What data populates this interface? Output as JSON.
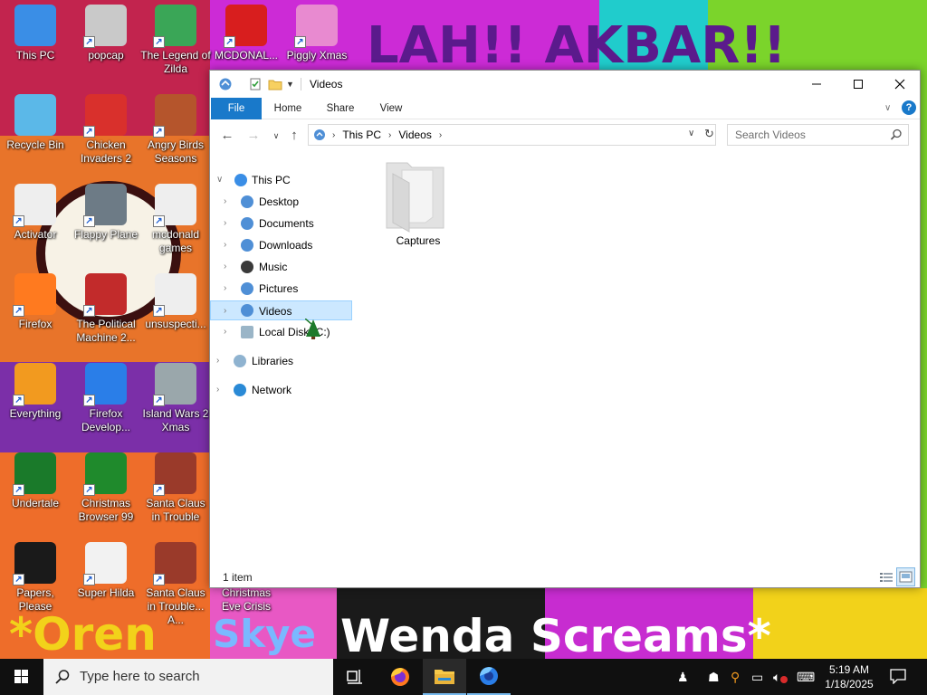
{
  "wallpaper": {
    "top_banner": "LAH!! AKBAR!!",
    "bottom_left": "*Oren",
    "bottom_mid": "Skye",
    "bottom_right": "Wenda Screams*"
  },
  "desktop_icons": [
    {
      "label": "This PC",
      "icon": "this-pc-icon",
      "color": "#3a8ee6"
    },
    {
      "label": "popcap",
      "icon": "popcap-icon",
      "color": "#c9c9c9"
    },
    {
      "label": "The Legend of Zilda",
      "icon": "zilda-icon",
      "color": "#3aa657"
    },
    {
      "label": "MCDONAL...",
      "icon": "mcdonalds-icon",
      "color": "#d81e1e"
    },
    {
      "label": "Piggly Xmas",
      "icon": "piggly-icon",
      "color": "#e88ad0"
    },
    {
      "label": "Recycle Bin",
      "icon": "recycle-bin-icon",
      "color": "#5bb8e8"
    },
    {
      "label": "Chicken Invaders 2",
      "icon": "chicken-icon",
      "color": "#d9302c"
    },
    {
      "label": "Angry Birds Seasons",
      "icon": "angry-birds-icon",
      "color": "#b5552c"
    },
    {
      "label": "Activator",
      "icon": "activator-icon",
      "color": "#eeeeee"
    },
    {
      "label": "Flappy Plane",
      "icon": "flappy-plane-icon",
      "color": "#6d7b86"
    },
    {
      "label": "mcdonald games",
      "icon": "mcdonald-games-icon",
      "color": "#eeeeee"
    },
    {
      "label": "Firefox",
      "icon": "firefox-icon",
      "color": "#ff7a1f"
    },
    {
      "label": "The Political Machine 2...",
      "icon": "political-machine-icon",
      "color": "#c22b2b"
    },
    {
      "label": "unsuspecti...",
      "icon": "unsuspecting-icon",
      "color": "#eeeeee"
    },
    {
      "label": "Everything",
      "icon": "everything-icon",
      "color": "#f29a1f"
    },
    {
      "label": "Firefox Develop...",
      "icon": "firefox-dev-icon",
      "color": "#2a7ee8"
    },
    {
      "label": "Island Wars 2 Xmas",
      "icon": "island-wars-icon",
      "color": "#9aa7ab"
    },
    {
      "label": "Undertale",
      "icon": "undertale-icon",
      "color": "#1a7a2a"
    },
    {
      "label": "Christmas Browser 99",
      "icon": "christmas-browser-icon",
      "color": "#1f8a2c"
    },
    {
      "label": "Santa Claus in Trouble",
      "icon": "santa-icon",
      "color": "#9a3a2a"
    },
    {
      "label": "Papers, Please",
      "icon": "papers-please-icon",
      "color": "#1a1a1a"
    },
    {
      "label": "Super Hilda",
      "icon": "super-hilda-icon",
      "color": "#f2f2f2"
    },
    {
      "label": "Santa Claus in Trouble... A...",
      "icon": "santa-2-icon",
      "color": "#9a3a2a"
    },
    {
      "label": "Christmas Eve Crisis",
      "icon": "christmas-eve-icon",
      "color": "#3a7ac8"
    }
  ],
  "explorer": {
    "title": "Videos",
    "tabs": [
      "File",
      "Home",
      "Share",
      "View"
    ],
    "breadcrumb": [
      "This PC",
      "Videos"
    ],
    "search_placeholder": "Search Videos",
    "nav_items": [
      {
        "label": "This PC",
        "icon": "this-pc-icon",
        "color": "#3a8ee6"
      },
      {
        "label": "Desktop",
        "icon": "desktop-icon",
        "color": "#4f8fd6"
      },
      {
        "label": "Documents",
        "icon": "documents-icon",
        "color": "#4f8fd6"
      },
      {
        "label": "Downloads",
        "icon": "downloads-icon",
        "color": "#4f8fd6"
      },
      {
        "label": "Music",
        "icon": "music-icon",
        "color": "#3a3a3a"
      },
      {
        "label": "Pictures",
        "icon": "pictures-icon",
        "color": "#4f8fd6"
      },
      {
        "label": "Videos",
        "icon": "videos-icon",
        "color": "#4f8fd6"
      },
      {
        "label": "Local Disk (C:)",
        "icon": "disk-icon",
        "color": "#9ab5c7"
      },
      {
        "label": "Libraries",
        "icon": "libraries-icon",
        "color": "#8fb3d0"
      },
      {
        "label": "Network",
        "icon": "network-icon",
        "color": "#2a8ad6"
      }
    ],
    "files": [
      {
        "name": "Captures",
        "icon": "folder-icon"
      }
    ],
    "status": "1 item",
    "selection_color": "#cce8ff",
    "file_tab_color": "#1979ca"
  },
  "taskbar": {
    "search_placeholder": "Type here to search",
    "apps": [
      "task-view-icon",
      "firefox-icon",
      "file-explorer-icon",
      "firefox-dev-icon"
    ],
    "time": "5:19 AM",
    "date": "1/18/2025"
  }
}
